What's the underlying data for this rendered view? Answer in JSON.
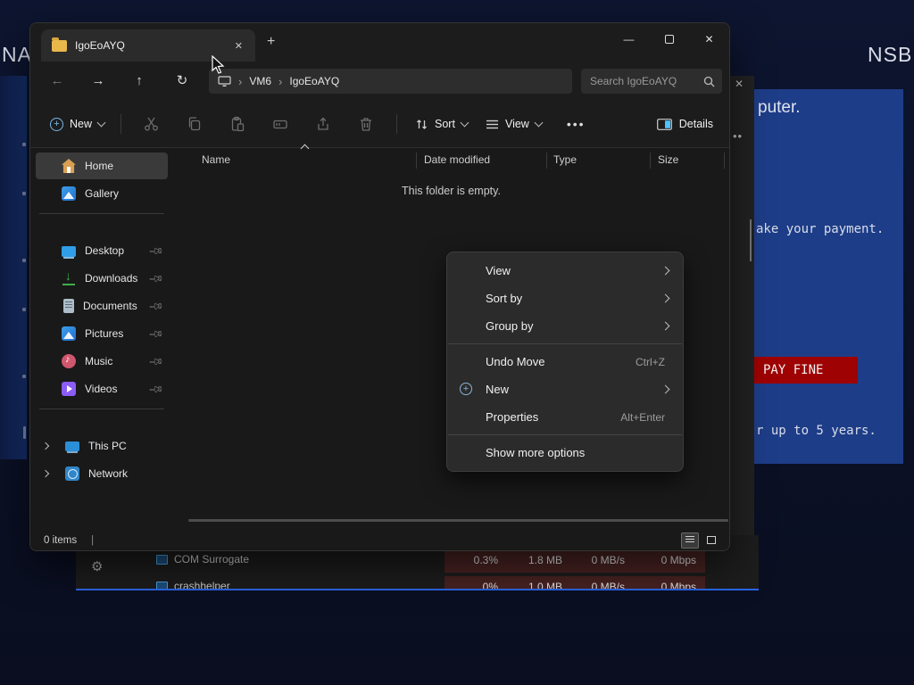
{
  "background": {
    "nav_text": "NAV",
    "nsb_text": "NSB",
    "ransom": {
      "line1": "puter.",
      "line2": "ake your payment.",
      "pay_button": "PAY FINE",
      "line3": "r up to 5 years.",
      "panel_color": "#1e3d88",
      "button_color": "#9e0202"
    }
  },
  "explorer": {
    "tab": {
      "title": "IgoEoAYQ"
    },
    "breadcrumb": {
      "crumbs": [
        "VM6",
        "IgoEoAYQ"
      ]
    },
    "search": {
      "placeholder": "Search IgoEoAYQ"
    },
    "toolbar": {
      "new_label": "New",
      "sort_label": "Sort",
      "view_label": "View",
      "more_label": "•••",
      "details_label": "Details"
    },
    "columns": [
      "Name",
      "Date modified",
      "Type",
      "Size"
    ],
    "empty_message": "This folder is empty.",
    "sidebar": {
      "items": [
        {
          "label": "Home"
        },
        {
          "label": "Gallery"
        },
        {
          "label": "Desktop"
        },
        {
          "label": "Downloads"
        },
        {
          "label": "Documents"
        },
        {
          "label": "Pictures"
        },
        {
          "label": "Music"
        },
        {
          "label": "Videos"
        }
      ],
      "tree": [
        {
          "label": "This PC"
        },
        {
          "label": "Network"
        }
      ]
    },
    "status": {
      "items_count": "0 items"
    }
  },
  "context_menu": {
    "items": [
      {
        "label": "View"
      },
      {
        "label": "Sort by"
      },
      {
        "label": "Group by"
      },
      {
        "label": "Undo Move",
        "shortcut": "Ctrl+Z"
      },
      {
        "label": "New"
      },
      {
        "label": "Properties",
        "shortcut": "Alt+Enter"
      },
      {
        "label": "Show more options"
      }
    ]
  },
  "task_manager": {
    "rows": [
      {
        "name": "COM Surrogate",
        "cpu": "0.3%",
        "mem": "1.8 MB",
        "disk": "0 MB/s",
        "net": "0 Mbps"
      },
      {
        "name": "crashhelper",
        "cpu": "0%",
        "mem": "1.0 MB",
        "disk": "0 MB/s",
        "net": "0 Mbps"
      }
    ]
  }
}
